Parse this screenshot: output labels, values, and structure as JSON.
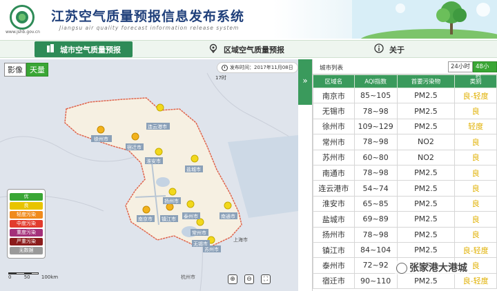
{
  "header": {
    "title": "江苏空气质量预报信息发布系统",
    "subtitle": "Jiangsu air quality forecast information release system",
    "site_url": "www.jshb.gov.cn"
  },
  "nav": {
    "items": [
      {
        "label": "城市空气质量预报",
        "icon": "building-icon"
      },
      {
        "label": "区域空气质量预报",
        "icon": "location-pin-icon"
      },
      {
        "label": "关于",
        "icon": "info-icon"
      }
    ]
  },
  "map": {
    "toggle": [
      "影像",
      "天量"
    ],
    "release_time": "发布时间：2017年11月08日",
    "hour_label": "17时",
    "legend": [
      {
        "label": "优",
        "color": "#3aa635"
      },
      {
        "label": "良",
        "color": "#e8c400"
      },
      {
        "label": "轻度污染",
        "color": "#f08a1c"
      },
      {
        "label": "中度污染",
        "color": "#e23b2e"
      },
      {
        "label": "重度污染",
        "color": "#a4307a"
      },
      {
        "label": "严重污染",
        "color": "#8b1c1c"
      },
      {
        "label": "无数据",
        "color": "#9a9a9a"
      }
    ],
    "scale": [
      "0",
      "50",
      "100km"
    ],
    "city_labels": [
      "徐州市",
      "连云港市",
      "宿迁市",
      "淮安市",
      "盐城市",
      "扬州市",
      "南京市",
      "镇江市",
      "泰州市",
      "常州市",
      "南通市",
      "无锡市",
      "苏州市",
      "上海市",
      "杭州市"
    ],
    "tools": [
      "zoom-in-icon",
      "zoom-out-icon",
      "fullscreen-icon"
    ]
  },
  "panel": {
    "title": "城市列表",
    "buttons": [
      "24小时",
      "48小时"
    ],
    "columns": [
      "区域名",
      "AQI指数",
      "首要污染物",
      "类别"
    ],
    "rows": [
      [
        "南京市",
        "85~105",
        "PM2.5",
        "良-轻度"
      ],
      [
        "无锡市",
        "78~98",
        "PM2.5",
        "良"
      ],
      [
        "徐州市",
        "109~129",
        "PM2.5",
        "轻度"
      ],
      [
        "常州市",
        "78~98",
        "NO2",
        "良"
      ],
      [
        "苏州市",
        "60~80",
        "NO2",
        "良"
      ],
      [
        "南通市",
        "78~98",
        "PM2.5",
        "良"
      ],
      [
        "连云港市",
        "54~74",
        "PM2.5",
        "良"
      ],
      [
        "淮安市",
        "65~85",
        "PM2.5",
        "良"
      ],
      [
        "盐城市",
        "69~89",
        "PM2.5",
        "良"
      ],
      [
        "扬州市",
        "78~98",
        "PM2.5",
        "良"
      ],
      [
        "镇江市",
        "84~104",
        "PM2.5",
        "良-轻度"
      ],
      [
        "泰州市",
        "72~92",
        "PM2.5",
        "良"
      ],
      [
        "宿迁市",
        "90~110",
        "PM2.5",
        "良-轻度"
      ]
    ]
  },
  "watermark": "张家港大港城"
}
